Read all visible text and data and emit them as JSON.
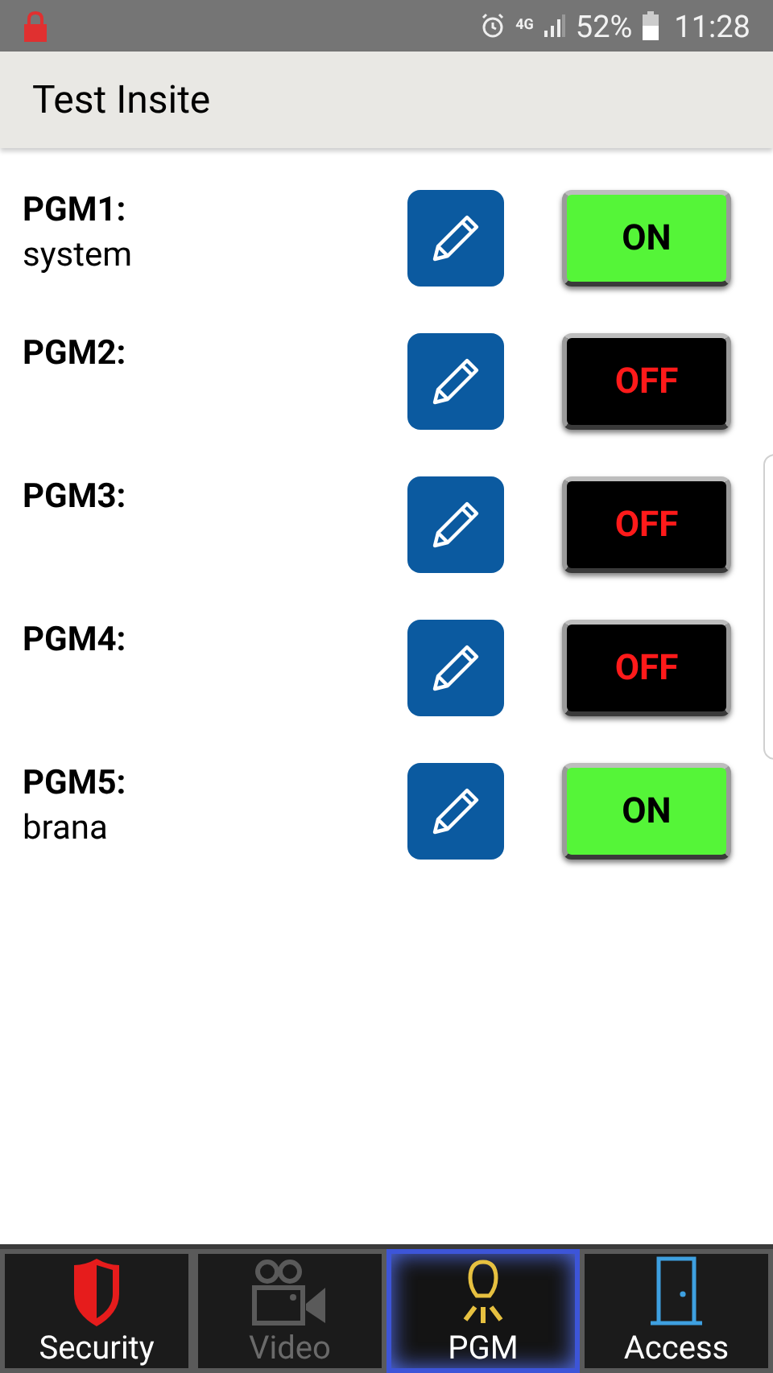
{
  "status_bar": {
    "network": "4G",
    "battery": "52%",
    "time": "11:28"
  },
  "header": {
    "title": "Test Insite"
  },
  "outputs": [
    {
      "name": "PGM1:",
      "description": "system",
      "on": true,
      "state_label": "ON"
    },
    {
      "name": "PGM2:",
      "on": false,
      "state_label": "OFF"
    },
    {
      "name": "PGM3:",
      "on": false,
      "state_label": "OFF"
    },
    {
      "name": "PGM4:",
      "on": false,
      "state_label": "OFF"
    },
    {
      "name": "PGM5:",
      "description": "brana",
      "on": true,
      "state_label": "ON"
    }
  ],
  "tabs": [
    {
      "kind": "security",
      "label": "Security",
      "selected": false,
      "disabled": false
    },
    {
      "kind": "video",
      "label": "Video",
      "selected": false,
      "disabled": true
    },
    {
      "kind": "pgm",
      "label": "PGM",
      "selected": true,
      "disabled": false
    },
    {
      "kind": "access",
      "label": "Access",
      "selected": false,
      "disabled": false
    }
  ]
}
